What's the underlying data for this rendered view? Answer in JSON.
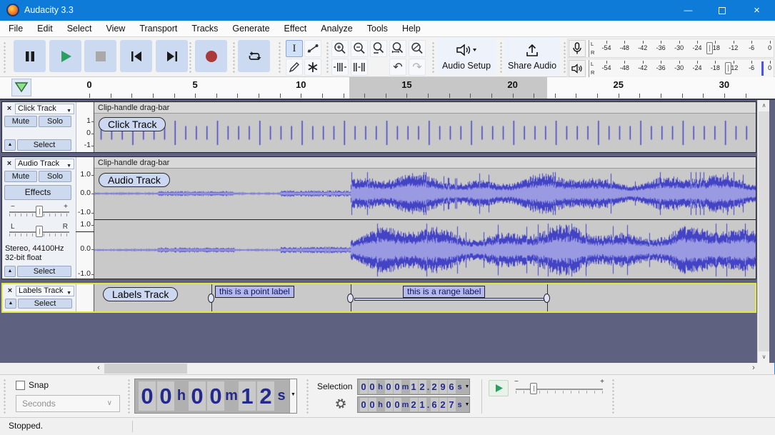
{
  "titlebar": {
    "title": "Audacity 3.3"
  },
  "window_controls": {
    "minimize": "—",
    "close": "×"
  },
  "menus": [
    "File",
    "Edit",
    "Select",
    "View",
    "Transport",
    "Tracks",
    "Generate",
    "Effect",
    "Analyze",
    "Tools",
    "Help"
  ],
  "toolbar": {
    "audio_setup_label": "Audio Setup",
    "share_audio_label": "Share Audio"
  },
  "meters": {
    "scale": [
      "-54",
      "-48",
      "-42",
      "-36",
      "-30",
      "-24",
      "-18",
      "-12",
      "-6",
      "0"
    ],
    "record_channels": [
      "L",
      "R"
    ],
    "play_channels": [
      "L",
      "R"
    ]
  },
  "ruler": {
    "labels": [
      "0",
      "5",
      "10",
      "15",
      "20",
      "25",
      "30"
    ],
    "label_seconds": [
      0,
      5,
      10,
      15,
      20,
      25,
      30
    ]
  },
  "tracks": {
    "click": {
      "name": "Click Track",
      "mute": "Mute",
      "solo": "Solo",
      "select": "Select",
      "clip_bar": "Clip-handle drag-bar",
      "clip_name": "Click Track",
      "scale": [
        "1",
        "0",
        "-1"
      ]
    },
    "audio": {
      "name": "Audio Track",
      "mute": "Mute",
      "solo": "Solo",
      "effects": "Effects",
      "select": "Select",
      "clip_bar": "Clip-handle drag-bar",
      "clip_name": "Audio Track",
      "format_line1": "Stereo, 44100Hz",
      "format_line2": "32-bit float",
      "scale_top": [
        "1.0",
        "0.0",
        "-1.0"
      ],
      "scale_bottom": [
        "1.0",
        "0.0",
        "-1.0"
      ],
      "gain_minus": "−",
      "gain_plus": "+",
      "pan_left": "L",
      "pan_right": "R"
    },
    "labels": {
      "name": "Labels Track",
      "select": "Select",
      "clip_name": "Labels Track",
      "point_label": "this is a point label",
      "range_label": "this is a range label"
    }
  },
  "audio_data": {
    "selection_start_s": 12.296,
    "selection_end_s": 21.627,
    "point_label_s": 5.74,
    "range_label_start_s": 12.296,
    "range_label_end_s": 21.627,
    "click_interval_s": 0.5,
    "click_accent_every": 4,
    "loud_from_s": 12.3,
    "timeline_visible_range_s": [
      0,
      31.5
    ]
  },
  "bottom": {
    "snap_label": "Snap",
    "snap_mode": "Seconds",
    "big_time": [
      "00",
      "h",
      "00",
      "m",
      "12",
      "s"
    ],
    "selection_label": "Selection",
    "selection_start": [
      "00",
      "h",
      "00",
      "m",
      "12.296",
      "s"
    ],
    "selection_end": [
      "00",
      "h",
      "00",
      "m",
      "21.627",
      "s"
    ],
    "speed_minus": "−",
    "speed_plus": "+"
  },
  "statusbar": {
    "text": "Stopped."
  },
  "icons": {
    "dropdown": "▼",
    "field_dropdown": "▼",
    "collapse": "▲",
    "close_track": "×",
    "undo": "↶",
    "redo": "↷",
    "multitool": "∗",
    "ibeam": "I",
    "scroll_left": "‹",
    "scroll_right": "›",
    "scroll_up": "∧",
    "scroll_down": "∨",
    "combo_chevron": "∨"
  },
  "colors": {
    "titlebar": "#0d7bd7",
    "accent_button": "#cbd9f1",
    "wave_dark": "#4343c6",
    "wave_light": "#9a9ae2",
    "track_bg": "#c9c9c9",
    "empty_area": "#5e6280",
    "selected_track_border": "#e6e640",
    "digit_navy": "#232a8c"
  }
}
